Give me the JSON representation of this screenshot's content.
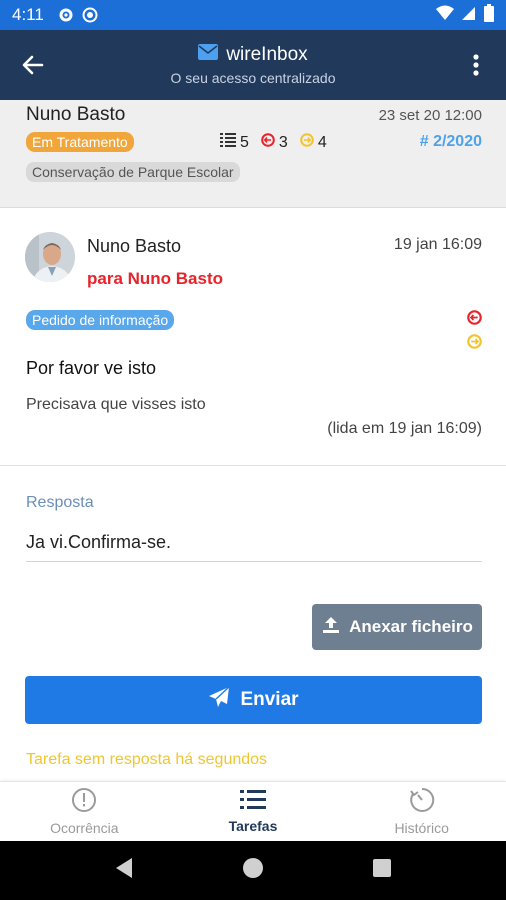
{
  "status_bar": {
    "time": "4:11"
  },
  "app_bar": {
    "title": "wireInbox",
    "subtitle": "O seu acesso centralizado"
  },
  "ticket": {
    "author": "Nuno Basto",
    "date": "23 set 20 12:00",
    "status": "Em Tratamento",
    "status_color": "#f0a63a",
    "count_tasks": "5",
    "count_red": "3",
    "count_yellow": "4",
    "reference": "# 2/2020",
    "category": "Conservação de Parque Escolar"
  },
  "message": {
    "from": "Nuno Basto",
    "to": "para Nuno Basto",
    "date": "19 jan 16:09",
    "type": "Pedido de informação",
    "subject": "Por favor ve isto",
    "body": "Precisava que visses isto",
    "read_status": "(lida em 19 jan 16:09)"
  },
  "reply": {
    "label": "Resposta",
    "value": "Ja vi.Confirma-se.",
    "attach_label": "Anexar ficheiro",
    "send_label": "Enviar",
    "notice": "Tarefa sem resposta há segundos"
  },
  "bottom_nav": {
    "items": [
      {
        "label": "Ocorrência",
        "icon": "alert-circle-icon"
      },
      {
        "label": "Tarefas",
        "icon": "list-icon"
      },
      {
        "label": "Histórico",
        "icon": "timer-icon"
      }
    ],
    "active": "Tarefas"
  },
  "colors": {
    "status_bar": "#1d6fd8",
    "app_bar": "#213a5c",
    "send_button": "#1f7ae6",
    "attach_button": "#6f7f92",
    "red_flag": "#e8232a",
    "yellow_flag": "#f2c32c"
  }
}
